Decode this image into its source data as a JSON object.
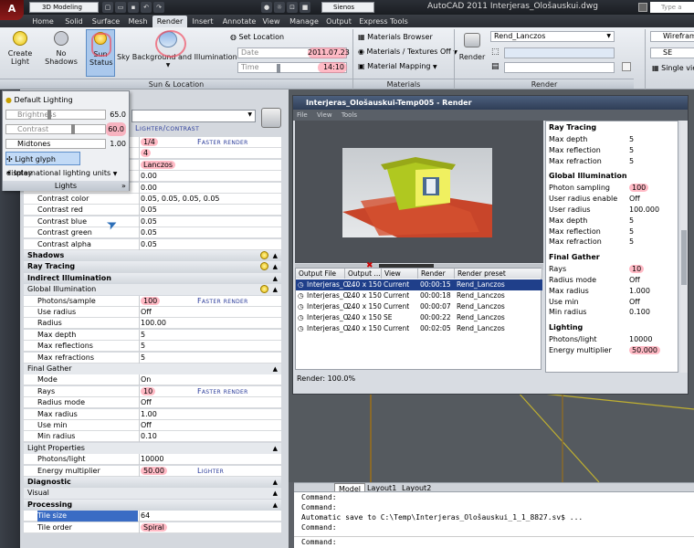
{
  "titlebar": {
    "app_button": "A",
    "workspace": "3D Modeling",
    "layer": "Sienos",
    "title": "AutoCAD 2011   Interjeras_Ološauskui.dwg",
    "search_placeholder": "Type a keyword"
  },
  "tabs": [
    "Home",
    "Solid",
    "Surface",
    "Mesh",
    "Render",
    "Insert",
    "Annotate",
    "View",
    "Manage",
    "Output",
    "Express Tools"
  ],
  "ribbon": {
    "create_light": "Create Light",
    "no_shadows": "No Shadows",
    "sun_status": "Sun Status",
    "sky_bg": "Sky Background and Illumination",
    "set_location": "Set Location",
    "date_label": "Date",
    "date_value": "2011.07.23",
    "time_label": "Time",
    "time_value": "14:10",
    "panel_sun": "Sun & Location",
    "materials_browser": "Materials Browser",
    "materials_textures": "Materials / Textures Off",
    "material_mapping": "Material Mapping",
    "panel_materials": "Materials",
    "render": "Render",
    "preset": "Rend_Lanczos",
    "panel_render": "Render",
    "wireframe": "Wireframe",
    "view_se": "SE",
    "single_view": "Single vie"
  },
  "flyout": {
    "default_lighting": "Default Lighting",
    "brightness_label": "Brightness",
    "brightness_value": "65.0",
    "contrast_label": "Contrast",
    "contrast_value": "60.0",
    "midtones_label": "Midtones",
    "midtones_value": "1.00",
    "light_glyph": "Light glyph display",
    "intl_units": "International lighting units",
    "panel_label": "Lights"
  },
  "palette": {
    "lighter_contrast": "Lighter/contrast",
    "faster_render": "Faster render",
    "lighter": "Lighter",
    "rows_top": [
      {
        "k": "",
        "v": "1/4",
        "hint": "Faster render"
      },
      {
        "k": "",
        "v": "4",
        "hint": ""
      },
      {
        "k": "",
        "v": "Lanczos",
        "hint": ""
      },
      {
        "k": "",
        "v": "0.00",
        "hint": ""
      },
      {
        "k": "",
        "v": "0.00",
        "hint": ""
      },
      {
        "k": "Contrast color",
        "v": "0.05, 0.05, 0.05, 0.05",
        "hint": ""
      },
      {
        "k": "Contrast red",
        "v": "0.05",
        "hint": ""
      },
      {
        "k": "Contrast blue",
        "v": "0.05",
        "hint": ""
      },
      {
        "k": "Contrast green",
        "v": "0.05",
        "hint": ""
      },
      {
        "k": "Contrast alpha",
        "v": "0.05",
        "hint": ""
      }
    ],
    "shadows": "Shadows",
    "ray_tracing": "Ray Tracing",
    "indirect": "Indirect Illumination",
    "global_illum": "Global Illumination",
    "gi_rows": [
      {
        "k": "Photons/sample",
        "v": "100",
        "hint": "Faster render"
      },
      {
        "k": "Use radius",
        "v": "Off",
        "hint": ""
      },
      {
        "k": "Radius",
        "v": "100.00",
        "hint": ""
      },
      {
        "k": "Max depth",
        "v": "5",
        "hint": ""
      },
      {
        "k": "Max reflections",
        "v": "5",
        "hint": ""
      },
      {
        "k": "Max refractions",
        "v": "5",
        "hint": ""
      }
    ],
    "final_gather": "Final Gather",
    "fg_rows": [
      {
        "k": "Mode",
        "v": "On",
        "hint": ""
      },
      {
        "k": "Rays",
        "v": "10",
        "hint": "Faster render"
      },
      {
        "k": "Radius mode",
        "v": "Off",
        "hint": ""
      },
      {
        "k": "Max radius",
        "v": "1.00",
        "hint": ""
      },
      {
        "k": "Use min",
        "v": "Off",
        "hint": ""
      },
      {
        "k": "Min radius",
        "v": "0.10",
        "hint": ""
      }
    ],
    "light_props": "Light Properties",
    "lp_rows": [
      {
        "k": "Photons/light",
        "v": "10000",
        "hint": ""
      },
      {
        "k": "Energy multiplier",
        "v": "50.00",
        "hint": "Lighter"
      }
    ],
    "diagnostic": "Diagnostic",
    "visual": "Visual",
    "processing": "Processing",
    "proc_rows": [
      {
        "k": "Tile size",
        "v": "64"
      },
      {
        "k": "Tile order",
        "v": "Spiral"
      }
    ]
  },
  "render_window": {
    "title": "Interjeras_Ološauskui-Temp005 - Render",
    "menu": [
      "File",
      "View",
      "Tools"
    ],
    "status": "Render: 100.0%",
    "headers": [
      "Output File Name",
      "Output ...",
      "View",
      "Render ...",
      "Render preset"
    ],
    "rows": [
      [
        "Interjeras_O...",
        "240 x 150",
        "Current",
        "00:00:15",
        "Rend_Lanczos"
      ],
      [
        "Interjeras_O...",
        "240 x 150",
        "Current",
        "00:00:18",
        "Rend_Lanczos"
      ],
      [
        "Interjeras_O...",
        "240 x 150",
        "Current",
        "00:00:07",
        "Rend_Lanczos"
      ],
      [
        "Interjeras_O...",
        "240 x 150",
        "SE",
        "00:00:22",
        "Rend_Lanczos"
      ],
      [
        "Interjeras_O...",
        "240 x 150",
        "Current",
        "00:02:05",
        "Rend_Lanczos"
      ]
    ],
    "stats": [
      {
        "h": "Ray Tracing"
      },
      {
        "k": "Max depth",
        "v": "5"
      },
      {
        "k": "Max reflection",
        "v": "5"
      },
      {
        "k": "Max refraction",
        "v": "5"
      },
      {
        "h": "Global Illumination"
      },
      {
        "k": "Photon sampling",
        "v": "100"
      },
      {
        "k": "User radius enable",
        "v": "Off"
      },
      {
        "k": "User radius",
        "v": "100.000"
      },
      {
        "k": "Max depth",
        "v": "5"
      },
      {
        "k": "Max reflection",
        "v": "5"
      },
      {
        "k": "Max refraction",
        "v": "5"
      },
      {
        "h": "Final Gather"
      },
      {
        "k": "Rays",
        "v": "10"
      },
      {
        "k": "Radius mode",
        "v": "Off"
      },
      {
        "k": "Max radius",
        "v": "1.000"
      },
      {
        "k": "Use min",
        "v": "Off"
      },
      {
        "k": "Min radius",
        "v": "0.100"
      },
      {
        "h": "Lighting"
      },
      {
        "k": "Photons/light",
        "v": "10000"
      },
      {
        "k": "Energy multiplier",
        "v": "50.000"
      }
    ]
  },
  "layouts": [
    "Model",
    "Layout1",
    "Layout2"
  ],
  "command": [
    "Command:",
    "Command:",
    "Automatic save to C:\\Temp\\Interjeras_Ološauskui_1_1_8827.sv$ ...",
    "Command:",
    "",
    "Command:"
  ]
}
